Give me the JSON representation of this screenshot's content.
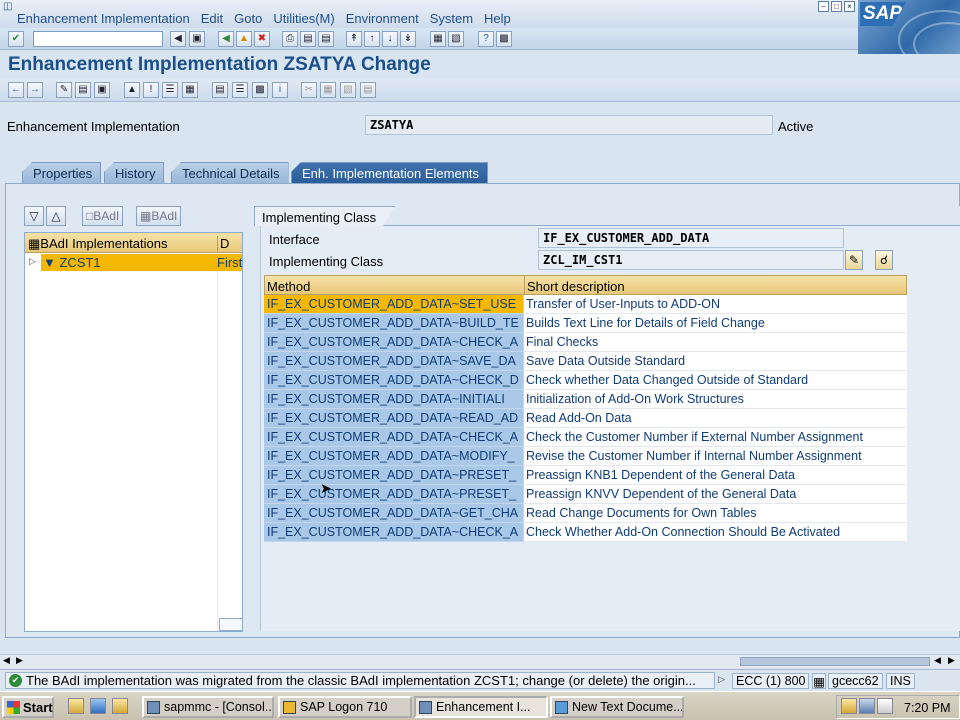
{
  "menubar": {
    "items": [
      "Enhancement Implementation",
      "Edit",
      "Goto",
      "Utilities(M)",
      "Environment",
      "System",
      "Help"
    ]
  },
  "logo": "SAP",
  "toolbar": {
    "command_value": ""
  },
  "title": "Enhancement Implementation ZSATYA Change",
  "header": {
    "label": "Enhancement Implementation",
    "value": "ZSATYA",
    "status": "Active"
  },
  "tabs": [
    {
      "label": "Properties",
      "active": false
    },
    {
      "label": "History",
      "active": false
    },
    {
      "label": "Technical Details",
      "active": false
    },
    {
      "label": "Enh. Implementation Elements",
      "active": true
    }
  ],
  "tree": {
    "buttons": [
      "BAdI",
      "BAdI"
    ],
    "col_name": "BAdI Implementations",
    "col_d": "D",
    "row_name": "ZCST1",
    "row_d": "First"
  },
  "panel": {
    "title": "Implementing Class",
    "interface_label": "Interface",
    "interface_value": "IF_EX_CUSTOMER_ADD_DATA",
    "class_label": "Implementing Class",
    "class_value": "ZCL_IM_CST1"
  },
  "table": {
    "col_method": "Method",
    "col_desc": "Short description",
    "rows": [
      {
        "method": "IF_EX_CUSTOMER_ADD_DATA~SET_USE",
        "desc": "Transfer of User-Inputs to ADD-ON"
      },
      {
        "method": "IF_EX_CUSTOMER_ADD_DATA~BUILD_TE",
        "desc": "Builds Text Line for Details of Field Change"
      },
      {
        "method": "IF_EX_CUSTOMER_ADD_DATA~CHECK_A",
        "desc": "Final Checks"
      },
      {
        "method": "IF_EX_CUSTOMER_ADD_DATA~SAVE_DA",
        "desc": "Save Data Outside Standard"
      },
      {
        "method": "IF_EX_CUSTOMER_ADD_DATA~CHECK_D",
        "desc": "Check whether Data Changed Outside of Standard"
      },
      {
        "method": "IF_EX_CUSTOMER_ADD_DATA~INITIALI",
        "desc": "Initialization of Add-On Work Structures"
      },
      {
        "method": "IF_EX_CUSTOMER_ADD_DATA~READ_AD",
        "desc": "Read Add-On Data"
      },
      {
        "method": "IF_EX_CUSTOMER_ADD_DATA~CHECK_A",
        "desc": "Check the Customer Number if External Number Assignment"
      },
      {
        "method": "IF_EX_CUSTOMER_ADD_DATA~MODIFY_",
        "desc": "Revise the Customer Number if Internal Number Assignment"
      },
      {
        "method": "IF_EX_CUSTOMER_ADD_DATA~PRESET_",
        "desc": "Preassign KNB1 Dependent of the General Data"
      },
      {
        "method": "IF_EX_CUSTOMER_ADD_DATA~PRESET_",
        "desc": "Preassign KNVV Dependent of the General Data"
      },
      {
        "method": "IF_EX_CUSTOMER_ADD_DATA~GET_CHA",
        "desc": "Read Change Documents for Own Tables"
      },
      {
        "method": "IF_EX_CUSTOMER_ADD_DATA~CHECK_A",
        "desc": "Check Whether Add-On Connection Should Be Activated"
      }
    ]
  },
  "status": {
    "message": "The BAdI implementation was migrated from the classic BAdI implementation ZCST1; change (or delete) the origin...",
    "system": "ECC (1) 800",
    "server": "gcecc62",
    "mode": "INS"
  },
  "taskbar": {
    "start": "Start",
    "tasks": [
      {
        "label": "sapmmc - [Consol...",
        "active": false
      },
      {
        "label": "SAP Logon 710",
        "active": false
      },
      {
        "label": "Enhancement I...",
        "active": true
      },
      {
        "label": "New Text Docume...",
        "active": false
      }
    ],
    "clock": "7:20 PM"
  },
  "colors": {
    "title": "#1b4f8a",
    "selection": "#f5b800",
    "method_column": "#a9c7e6",
    "active_tab": "#2b5d99"
  }
}
